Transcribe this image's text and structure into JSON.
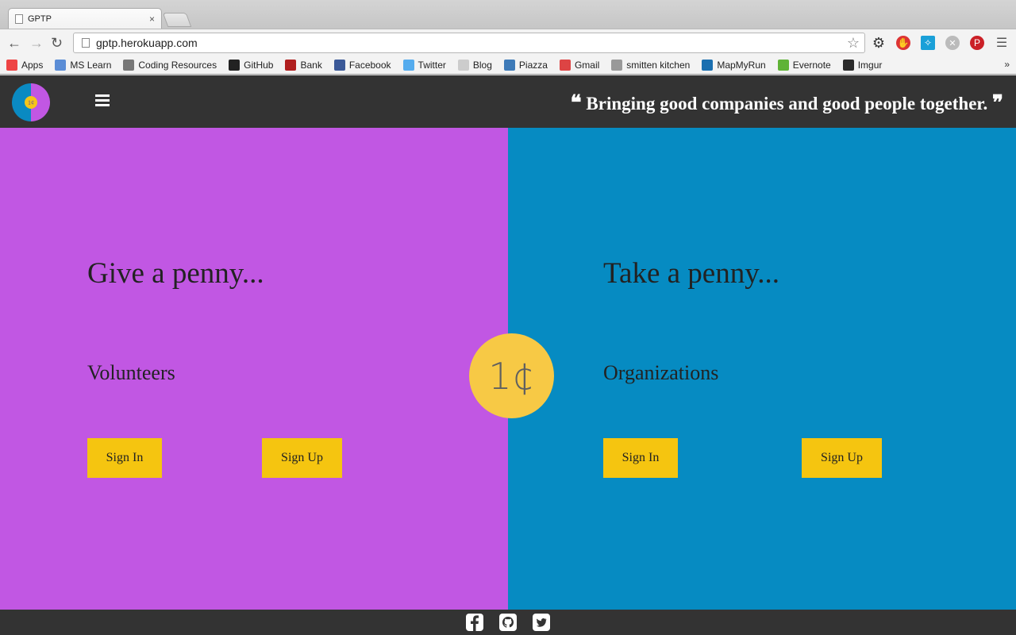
{
  "browser": {
    "tab_title": "GPTP",
    "tab_close": "×",
    "url": "gptp.herokuapp.com",
    "bookmarks": [
      {
        "label": "Apps",
        "color": "#e44"
      },
      {
        "label": "MS Learn",
        "color": "#5b8dd6"
      },
      {
        "label": "Coding Resources",
        "color": "#777"
      },
      {
        "label": "GitHub",
        "color": "#222"
      },
      {
        "label": "Bank",
        "color": "#b01e1e"
      },
      {
        "label": "Facebook",
        "color": "#3b5998"
      },
      {
        "label": "Twitter",
        "color": "#55acee"
      },
      {
        "label": "Blog",
        "color": "#ccc"
      },
      {
        "label": "Piazza",
        "color": "#3d7ab8"
      },
      {
        "label": "Gmail",
        "color": "#d44"
      },
      {
        "label": "smitten kitchen",
        "color": "#999"
      },
      {
        "label": "MapMyRun",
        "color": "#1a6fb0"
      },
      {
        "label": "Evernote",
        "color": "#5fb336"
      },
      {
        "label": "Imgur",
        "color": "#2b2b2b"
      }
    ],
    "more_bookmarks": "»"
  },
  "header": {
    "logo_coin": "1¢",
    "tagline": "Bringing good companies and good people together.",
    "open_quote": "❝",
    "close_quote": "❞"
  },
  "left_panel": {
    "heading": "Give a penny...",
    "subheading": "Volunteers",
    "sign_in": "Sign In",
    "sign_up": "Sign Up",
    "color": "#c157e3"
  },
  "right_panel": {
    "heading": "Take a penny...",
    "subheading": "Organizations",
    "sign_in": "Sign In",
    "sign_up": "Sign Up",
    "color": "#068bc2"
  },
  "center": {
    "penny": "1¢"
  },
  "colors": {
    "button": "#f5c510",
    "header": "#333333",
    "penny": "#f7c945"
  }
}
